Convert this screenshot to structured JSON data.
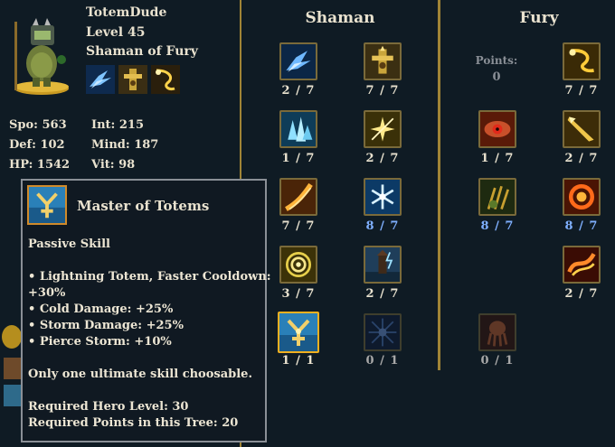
{
  "hero": {
    "name": "TotemDude",
    "level": "Level 45",
    "class": "Shaman of Fury",
    "stats": {
      "spo": "Spo: 563",
      "def": "Def: 102",
      "hp": "HP: 1542",
      "int": "Int: 215",
      "mind": "Mind: 187",
      "vit": "Vit: 98"
    }
  },
  "trees": {
    "shaman_title": "Shaman",
    "fury_title": "Fury",
    "points_label": "Points:",
    "points_value": "0"
  },
  "shaman_skills": [
    {
      "name": "ice-shard-skill",
      "count": "2 / 7"
    },
    {
      "name": "lightning-totem-skill",
      "count": "7 / 7"
    },
    {
      "name": "ice-crystal-skill",
      "count": "1 / 7"
    },
    {
      "name": "star-strike-skill",
      "count": "2 / 7"
    },
    {
      "name": "flame-slash-skill",
      "count": "7 / 7"
    },
    {
      "name": "snowflake-skill",
      "count": "8 / 7"
    },
    {
      "name": "spiral-skill",
      "count": "3 / 7"
    },
    {
      "name": "storm-tower-skill",
      "count": "2 / 7"
    },
    {
      "name": "master-of-totems-skill",
      "count": "1 / 1"
    },
    {
      "name": "locked-burst-skill",
      "count": "0 / 1"
    }
  ],
  "fury_skills": [
    {
      "name": "lightning-bolt-skill",
      "count": "7 / 7"
    },
    {
      "name": "fury-eye-skill",
      "count": "1 / 7"
    },
    {
      "name": "golden-spear-skill",
      "count": "2 / 7"
    },
    {
      "name": "claw-skill",
      "count": "8 / 7"
    },
    {
      "name": "fire-ring-skill",
      "count": "8 / 7"
    },
    {
      "name": "phoenix-skill",
      "count": "2 / 7"
    },
    {
      "name": "locked-squid-skill",
      "count": "0 / 1"
    }
  ],
  "tooltip": {
    "title": "Master of Totems",
    "type": "Passive Skill",
    "effect1a": "• Lightning Totem, Faster Cooldown:",
    "effect1b": "+30%",
    "effect2": "• Cold Damage: +25%",
    "effect3": "• Storm Damage: +25%",
    "effect4": "• Pierce Storm: +10%",
    "note": "Only one ultimate skill choosable.",
    "req1": "Required Hero Level: 30",
    "req2": "Required Points in this Tree: 20"
  },
  "colors": {
    "background": "#0f1b24",
    "divider": "#a08436",
    "over_cap": "#7fb0ff",
    "text": "#e9e2cf"
  }
}
